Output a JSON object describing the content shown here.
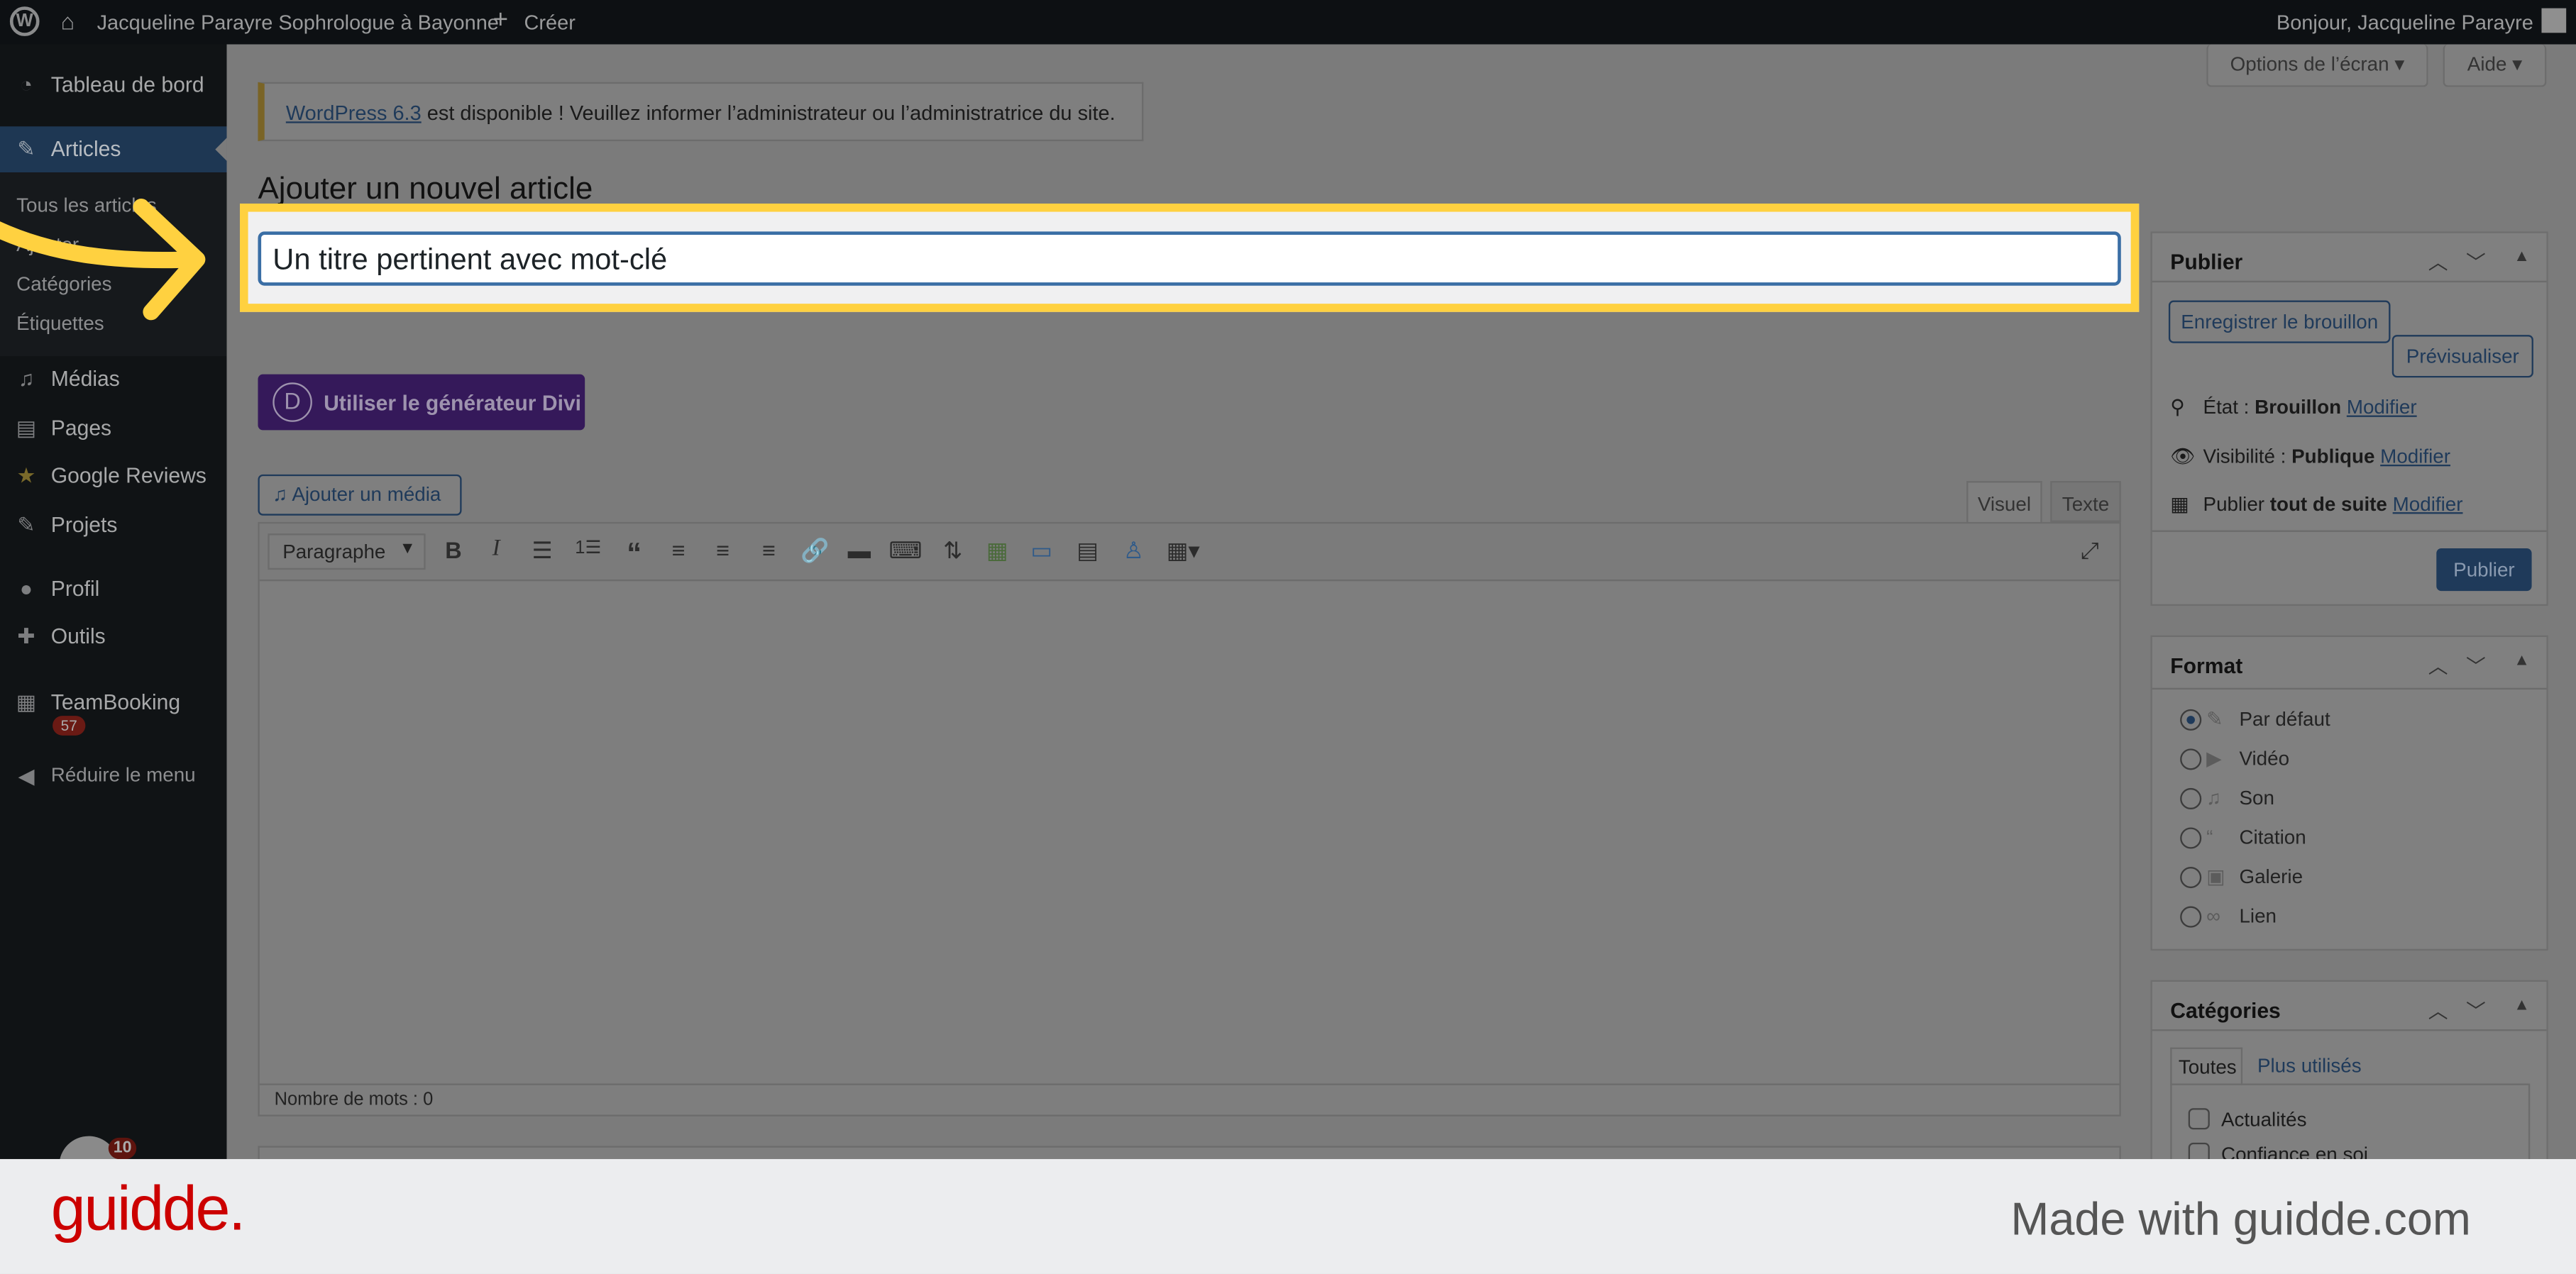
{
  "adminbar": {
    "wp_icon": "wordpress-logo-icon",
    "home_icon": "home-icon",
    "site_name": "Jacqueline Parayre Sophrologue à Bayonne",
    "create_label": "Créer",
    "greeting": "Bonjour, Jacqueline Parayre"
  },
  "screen_options": {
    "options_label": "Options de l’écran",
    "help_label": "Aide"
  },
  "sidebar": {
    "items": [
      {
        "label": "Tableau de bord",
        "icon": "dashboard-icon"
      },
      {
        "label": "Articles",
        "icon": "pin-icon"
      },
      {
        "label": "Médias",
        "icon": "media-icon"
      },
      {
        "label": "Pages",
        "icon": "pages-icon"
      },
      {
        "label": "Google Reviews",
        "icon": "star-icon"
      },
      {
        "label": "Projets",
        "icon": "pin-icon"
      },
      {
        "label": "Profil",
        "icon": "user-icon"
      },
      {
        "label": "Outils",
        "icon": "wrench-icon"
      },
      {
        "label": "TeamBooking",
        "icon": "calendar-icon",
        "badge": "57"
      },
      {
        "label": "Réduire le menu",
        "icon": "collapse-icon"
      }
    ],
    "submenu": [
      "Tous les articles",
      "Ajouter",
      "Catégories",
      "Étiquettes"
    ],
    "bottom_badge": "10"
  },
  "notice": {
    "link": "WordPress 6.3",
    "text": " est disponible ! Veuillez informer l’administrateur ou l’administratrice du site."
  },
  "page_title": "Ajouter un nouvel article",
  "title_input": {
    "value": "Un titre pertinent avec mot-clé"
  },
  "divi_button": "Utiliser le générateur Divi",
  "divi_letter": "D",
  "add_media": "Ajouter un média",
  "editor": {
    "tabs": [
      "Visuel",
      "Texte"
    ],
    "format_select": "Paragraphe",
    "word_count": "Nombre de mots : 0"
  },
  "publish": {
    "title": "Publier",
    "save_draft": "Enregistrer le brouillon",
    "preview": "Prévisualiser",
    "status_label": "État : ",
    "status_value": "Brouillon",
    "visibility_label": "Visibilité : ",
    "visibility_value": "Publique",
    "schedule_label": "Publier ",
    "schedule_value": "tout de suite",
    "modify": "Modifier",
    "publish_button": "Publier"
  },
  "format": {
    "title": "Format",
    "options": [
      "Par défaut",
      "Vidéo",
      "Son",
      "Citation",
      "Galerie",
      "Lien"
    ],
    "selected": "Par défaut"
  },
  "categories": {
    "title": "Catégories",
    "tabs": [
      "Toutes",
      "Plus utilisés"
    ],
    "items": [
      "Actualités",
      "Confiance en soi"
    ]
  },
  "footer": {
    "logo": "guidde.",
    "tagline": "Made with guidde.com"
  },
  "colors": {
    "highlight": "#ffd140",
    "brand": "#cc0000",
    "divi": "#35195a"
  }
}
